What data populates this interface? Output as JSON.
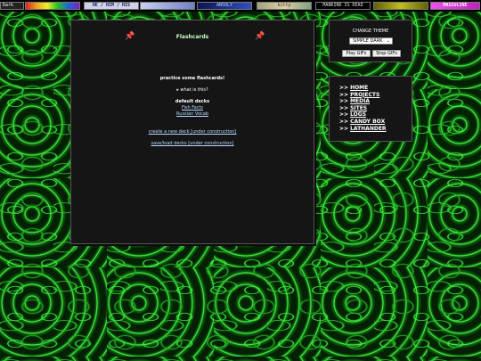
{
  "top_banner": {
    "badges": [
      {
        "text": "Dark",
        "bg": "#222222"
      },
      {
        "text": "",
        "bg": "#b8b8b8"
      },
      {
        "text": "HE / HIM / HIS",
        "bg": "#d0d0e8"
      },
      {
        "text": "",
        "bg": "#8fa0c8"
      },
      {
        "text": "ANSOLY",
        "bg": "#1a2a6c"
      },
      {
        "text": "kitty",
        "bg": "#c0c0a0"
      },
      {
        "text": "MANKIND IS DEAD",
        "bg": "#000000"
      },
      {
        "text": "",
        "bg": "#9aa01a"
      },
      {
        "text": "MASCULINE",
        "bg": "#d03ad0"
      }
    ]
  },
  "main": {
    "title": "Flashcards",
    "pin_icon": "pushpin-icon",
    "intro": "practice some flashcards!",
    "what_is_this": "▸ what is this?",
    "default_decks_heading": "default decks",
    "decks": [
      "Fish Facts",
      "Russian Vocab"
    ],
    "create_link": "create a new deck [under construction]",
    "saveload_link": "save/load decks [under construction]"
  },
  "theme": {
    "label": "CHANGE THEME",
    "selected": "SIMPLE DARK",
    "play_label": "Play GIFs",
    "stop_label": "Stop GIFs"
  },
  "nav": {
    "arrow": ">>",
    "items": [
      "HOME",
      "PROJECTS",
      "MEDIA",
      "SITES",
      "LOGS",
      "CANDY BOX",
      "LATHANDER"
    ]
  },
  "colors": {
    "panel": "#151515",
    "pin": "#e01010",
    "link": "#b8d8ff",
    "title": "#c8ffc8"
  }
}
